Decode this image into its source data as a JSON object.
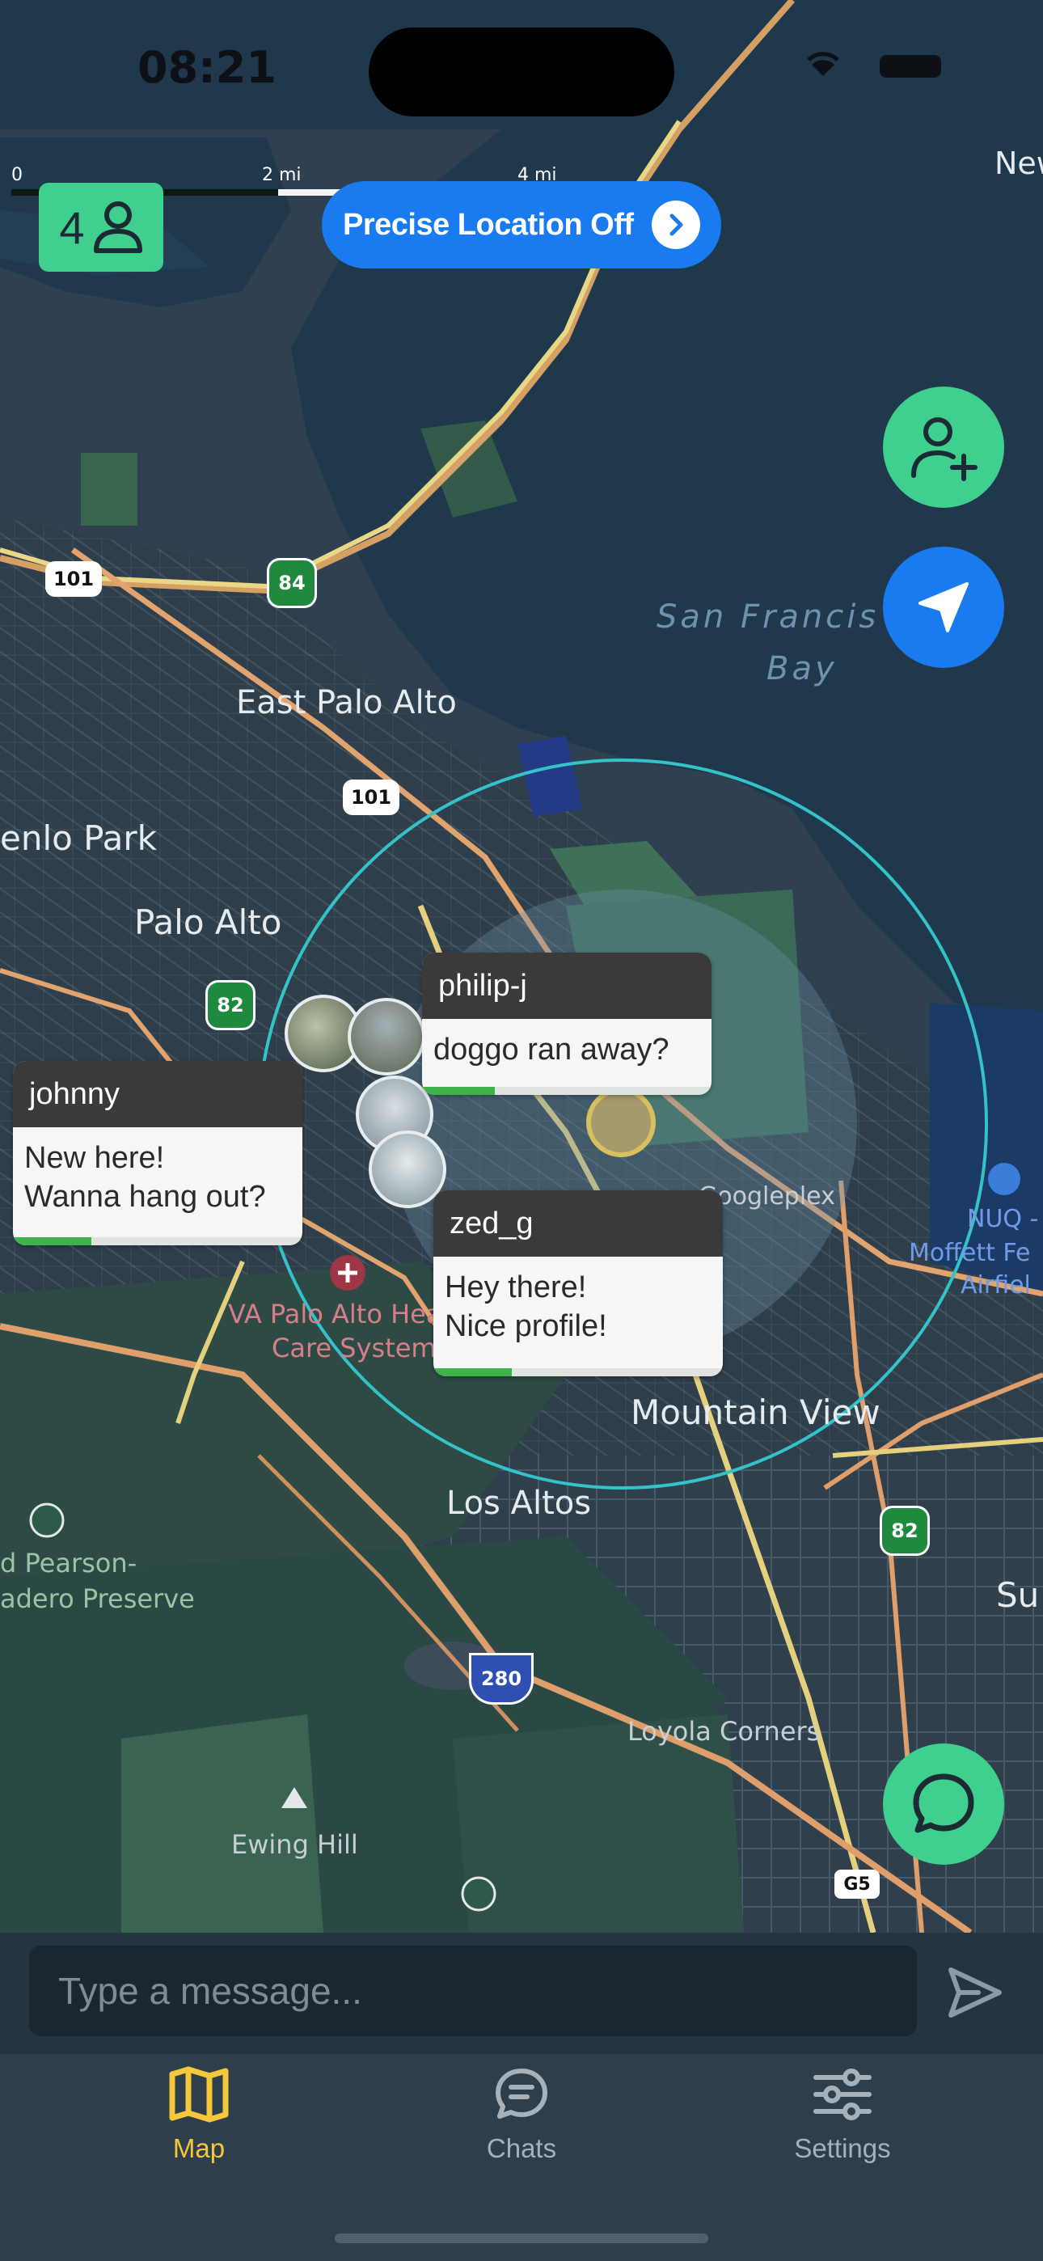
{
  "status_bar": {
    "time": "08:21"
  },
  "map": {
    "scale_labels": [
      "0",
      "2 mi",
      "4 mi"
    ],
    "friends_count": "4",
    "precise_location_label": "Precise Location Off",
    "place_labels": {
      "east_palo_alto": "East Palo Alto",
      "menlo_park": "enlo Park",
      "palo_alto": "Palo Alto",
      "mountain_view": "Mountain View",
      "los_altos": "Los Altos",
      "loyola_corners": "Loyola Corners",
      "ewing_hill": "Ewing Hill",
      "pearson_1": "d Pearson-",
      "pearson_2": "adero Preserve",
      "va_1": "VA Palo Alto Hea",
      "va_2": "Care System",
      "googleplex": "Googleplex",
      "nuq_1": "NUQ -",
      "nuq_2": "Moffett Fe",
      "nuq_3": "Airfiel",
      "new": "New",
      "su": "Su",
      "bay_1": "San Francis",
      "bay_2": "Bay"
    },
    "shields": {
      "us101a": "101",
      "us101b": "101",
      "ca84": "84",
      "ca82a": "82",
      "ca82b": "82",
      "i280": "280",
      "g5": "G5"
    }
  },
  "bubbles": [
    {
      "user": "philip-j",
      "message": "doggo ran away?",
      "progress": 0.25
    },
    {
      "user": "johnny",
      "message": "New here!\nWanna hang out?",
      "progress": 0.27
    },
    {
      "user": "zed_g",
      "message": "Hey there!\nNice profile!",
      "progress": 0.27
    }
  ],
  "composer": {
    "placeholder": "Type a message..."
  },
  "tabs": [
    {
      "label": "Map",
      "icon": "map-icon",
      "active": true
    },
    {
      "label": "Chats",
      "icon": "chat-bubble-icon",
      "active": false
    },
    {
      "label": "Settings",
      "icon": "sliders-icon",
      "active": false
    }
  ],
  "colors": {
    "accent_green": "#3fd08f",
    "accent_blue": "#1a7af0",
    "active_tab": "#f5c73a",
    "inactive_tab": "#a7b1b9",
    "range_circle": "#33c3c9"
  }
}
